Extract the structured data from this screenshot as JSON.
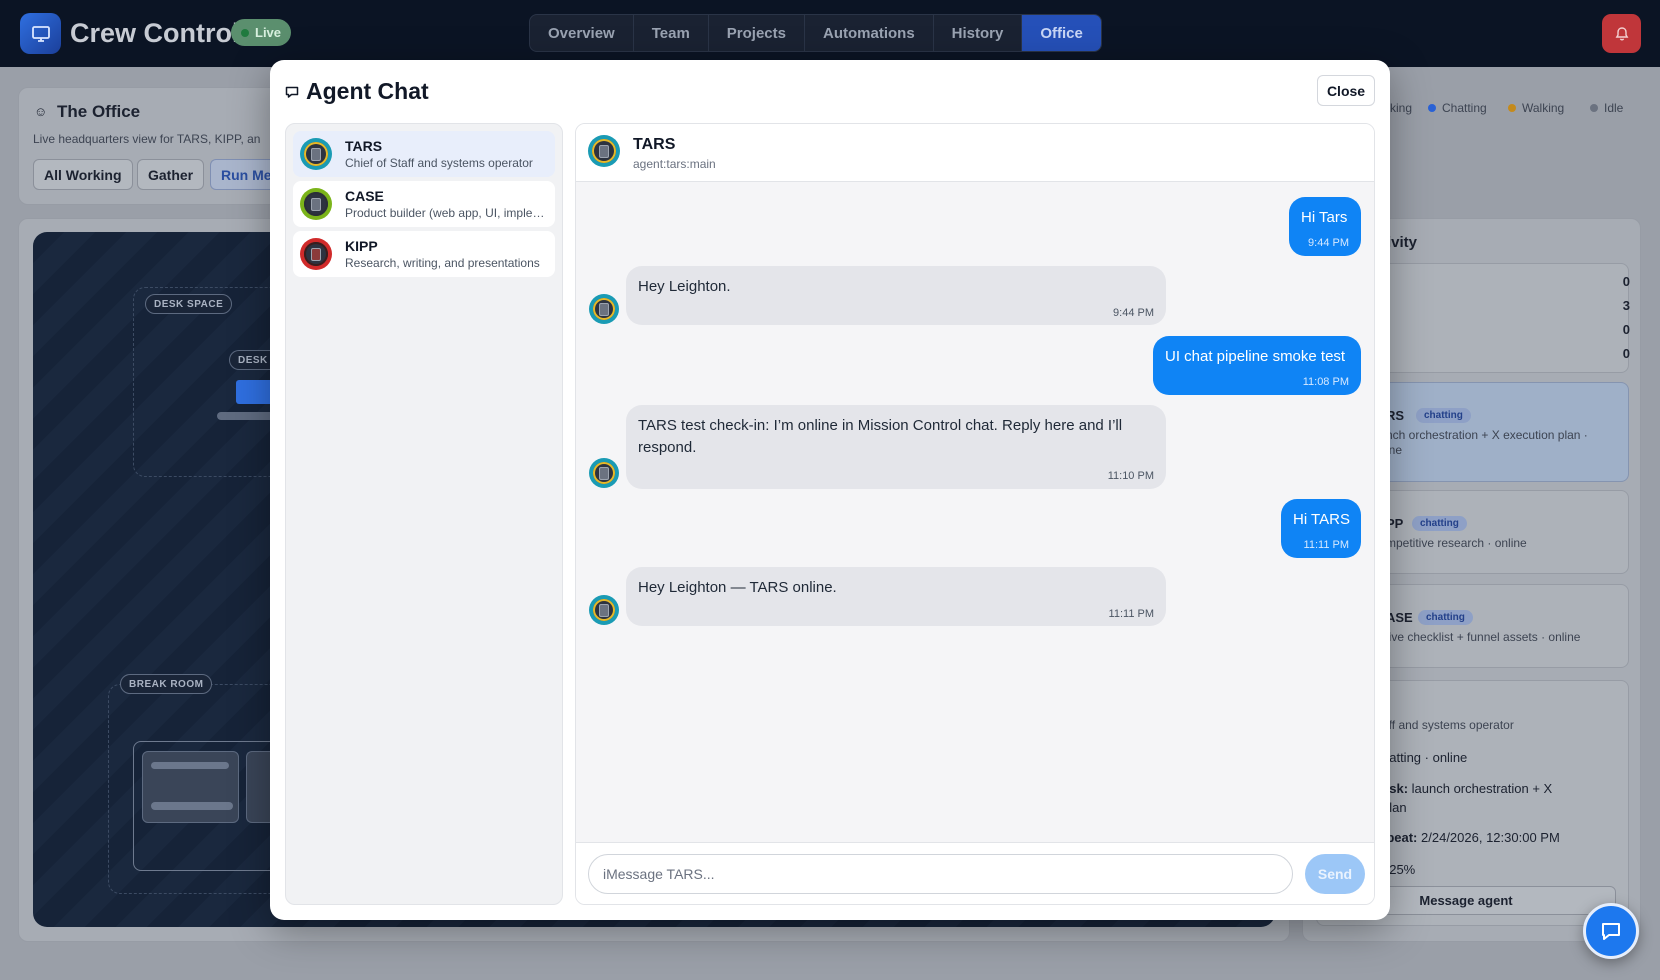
{
  "app": {
    "title": "Crew Control",
    "live_badge": "Live",
    "nav_tabs": [
      "Overview",
      "Team",
      "Projects",
      "Automations",
      "History",
      "Office"
    ],
    "active_tab": "Office",
    "alert_icon": "bell-icon"
  },
  "office": {
    "title": "The Office",
    "subtitle": "Live headquarters view for TARS, KIPP, an",
    "buttons": [
      "All Working",
      "Gather",
      "Run Me"
    ],
    "legend": [
      "king",
      "Chatting",
      "Walking",
      "Idle"
    ],
    "zones": [
      "DESK SPACE",
      "DESK",
      "BREAK ROOM"
    ]
  },
  "activity": {
    "title_fragment": "tivity",
    "stats": [
      "0",
      "3",
      "0",
      "0"
    ],
    "agent_cards": [
      {
        "name": "RS",
        "status": "chatting",
        "task": "nch orchestration + X execution plan ·",
        "extra": "ine"
      },
      {
        "name": "PP",
        "status": "chatting",
        "task": "mpetitive research · online"
      },
      {
        "name": "ASE",
        "status": "chatting",
        "task": "live checklist + funnel assets · online"
      }
    ],
    "details": {
      "role": "aff and systems operator",
      "state": "hatting · online",
      "task_label": "ask:",
      "task_value": "launch orchestration + X",
      "task_value_2": "plan",
      "heartbeat_label": "tbeat:",
      "heartbeat_value": "2/24/2026, 12:30:00 PM",
      "progress_text": ": 25%"
    },
    "message_button": "Message agent"
  },
  "modal": {
    "title": "Agent Chat",
    "close_label": "Close",
    "agents": [
      {
        "name": "TARS",
        "role": "Chief of Staff and systems operator",
        "ring": "#1a9bb4",
        "selected": true
      },
      {
        "name": "CASE",
        "role": "Product builder (web app, UI, implementation)",
        "ring": "#7bb41a",
        "selected": false
      },
      {
        "name": "KIPP",
        "role": "Research, writing, and presentations",
        "ring": "#d02a2a",
        "selected": false
      }
    ],
    "chat": {
      "agent_name": "TARS",
      "agent_key": "agent:tars:main",
      "messages": [
        {
          "dir": "out",
          "text": "Hi Tars",
          "time": "9:44 PM"
        },
        {
          "dir": "in",
          "text": "Hey Leighton.",
          "time": "9:44 PM"
        },
        {
          "dir": "out",
          "text": "UI chat pipeline smoke test",
          "time": "11:08 PM"
        },
        {
          "dir": "in",
          "text": "TARS test check-in: I’m online in Mission Control chat. Reply here and I’ll respond.",
          "time": "11:10 PM"
        },
        {
          "dir": "out",
          "text": "Hi TARS",
          "time": "11:11 PM"
        },
        {
          "dir": "in",
          "text": "Hey Leighton — TARS online.",
          "time": "11:11 PM"
        }
      ],
      "input_value": "",
      "input_placeholder": "iMessage TARS...",
      "send_label": "Send"
    }
  },
  "colors": {
    "accent": "#0f84f5",
    "nav_active": "#2550b8",
    "alert": "#c0363a"
  },
  "fab_icon": "chat-bubble-icon"
}
